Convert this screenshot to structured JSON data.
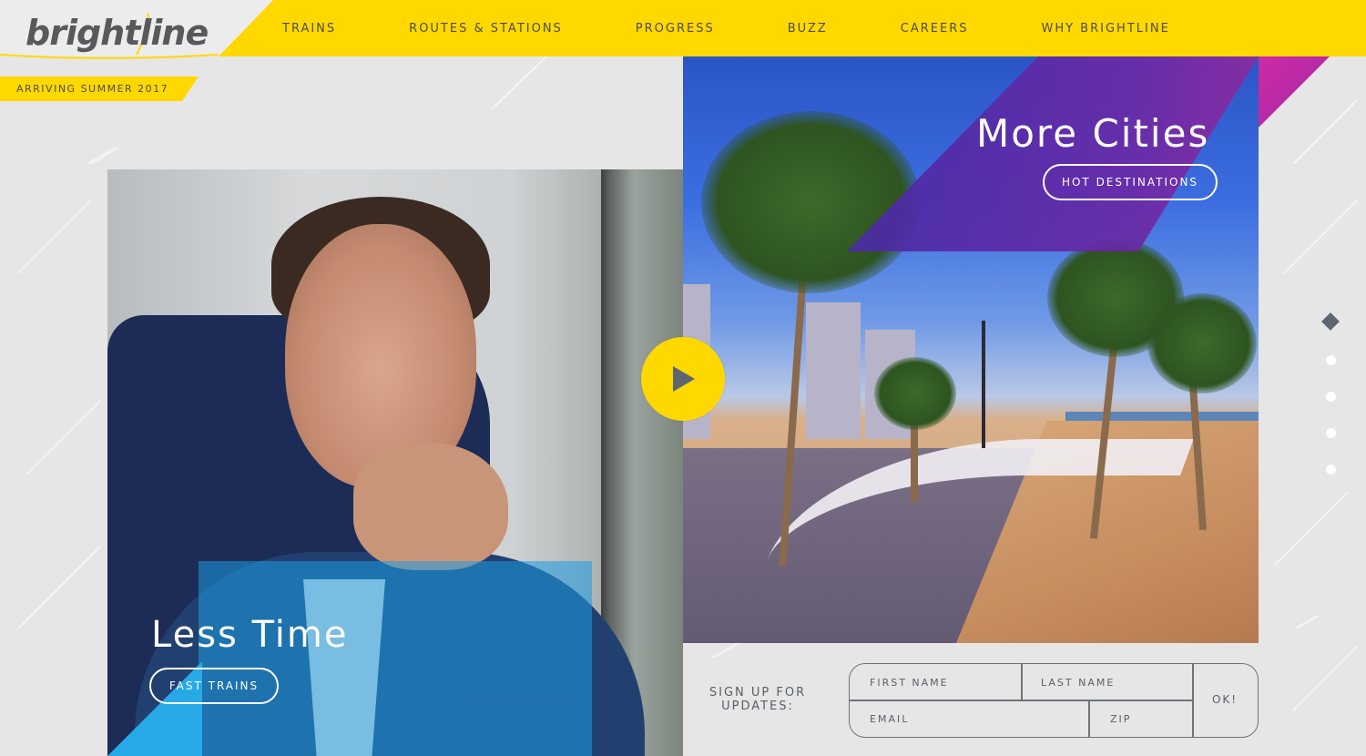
{
  "brand": {
    "logo_text": "brightline",
    "ribbon": "ARRIVING SUMMER 2017",
    "accent": "#ffd800"
  },
  "nav": {
    "items": [
      "TRAINS",
      "ROUTES & STATIONS",
      "PROGRESS",
      "BUZZ",
      "CAREERS",
      "WHY BRIGHTLINE"
    ]
  },
  "left_panel": {
    "headline": "Less Time",
    "button": "FAST TRAINS"
  },
  "right_panel": {
    "headline": "More Cities",
    "button": "HOT DESTINATIONS"
  },
  "play": {
    "icon": "play-icon"
  },
  "slides": {
    "count": 5,
    "active": 1
  },
  "signup": {
    "label": "SIGN UP FOR UPDATES:",
    "first_name_placeholder": "FIRST NAME",
    "last_name_placeholder": "LAST NAME",
    "email_placeholder": "EMAIL",
    "zip_placeholder": "ZIP",
    "submit": "OK!"
  },
  "colors": {
    "yellow": "#ffd800",
    "blue": "#27a9e7",
    "purple": "#5a2aa6",
    "magenta": "#cf2aa5",
    "gray_text": "#5a5f66"
  }
}
